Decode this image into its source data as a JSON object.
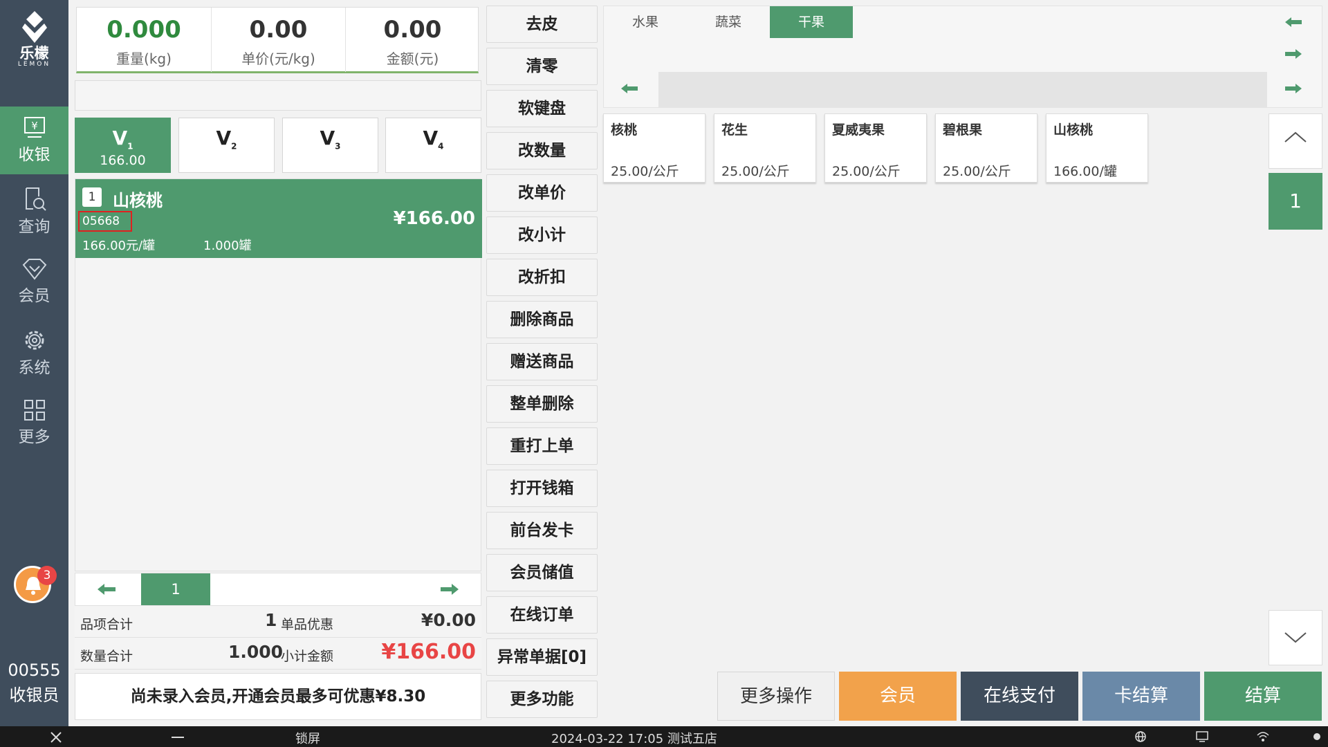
{
  "app": {
    "brand": "乐檬",
    "brand_sub": "LEMON"
  },
  "sidebar": {
    "items": [
      {
        "label": "收银",
        "icon": "cash-register-icon"
      },
      {
        "label": "查询",
        "icon": "search-doc-icon"
      },
      {
        "label": "会员",
        "icon": "diamond-icon"
      },
      {
        "label": "系统",
        "icon": "gear-icon"
      },
      {
        "label": "更多",
        "icon": "grid-icon"
      }
    ],
    "notification_count": "3",
    "cashier_id": "00555",
    "cashier_role": "收银员"
  },
  "scale": {
    "weight": {
      "value": "0.000",
      "label": "重量(kg)"
    },
    "unit_price": {
      "value": "0.00",
      "label": "单价(元/kg)"
    },
    "amount": {
      "value": "0.00",
      "label": "金额(元)"
    }
  },
  "vtabs": [
    {
      "name": "V",
      "sub": "1",
      "amount": "166.00"
    },
    {
      "name": "V",
      "sub": "2",
      "amount": ""
    },
    {
      "name": "V",
      "sub": "3",
      "amount": ""
    },
    {
      "name": "V",
      "sub": "4",
      "amount": ""
    }
  ],
  "cart": {
    "items": [
      {
        "line": "1",
        "name": "山核桃",
        "code": "05668",
        "total": "¥166.00",
        "price": "166.00元/罐",
        "qty": "1.000罐"
      }
    ],
    "page": "1"
  },
  "summary": {
    "item_count_label": "品项合计",
    "item_count": "1",
    "discount_label": "单品优惠",
    "discount": "¥0.00",
    "qty_label": "数量合计",
    "qty": "1.000",
    "subtotal_label": "小计金额",
    "subtotal": "¥166.00"
  },
  "promo_text": "尚未录入会员,开通会员最多可优惠¥8.30",
  "functions": [
    "去皮",
    "清零",
    "软键盘",
    "改数量",
    "改单价",
    "改小计",
    "改折扣",
    "删除商品",
    "赠送商品",
    "整单删除",
    "重打上单",
    "打开钱箱",
    "前台发卡",
    "会员储值",
    "在线订单",
    "异常单据[0]",
    "更多功能"
  ],
  "categories": [
    "水果",
    "蔬菜",
    "干果"
  ],
  "products": [
    {
      "name": "核桃",
      "price": "25.00/公斤"
    },
    {
      "name": "花生",
      "price": "25.00/公斤"
    },
    {
      "name": "夏威夷果",
      "price": "25.00/公斤"
    },
    {
      "name": "碧根果",
      "price": "25.00/公斤"
    },
    {
      "name": "山核桃",
      "price": "166.00/罐"
    }
  ],
  "product_page": "1",
  "actions": {
    "more": "更多操作",
    "member": "会员",
    "online": "在线支付",
    "card": "卡结算",
    "checkout": "结算"
  },
  "statusbar": {
    "lock": "锁屏",
    "datetime_store": "2024-03-22 17:05 测试五店"
  },
  "colors": {
    "accent": "#4f9a6e",
    "sidebar": "#3f4d5c",
    "member": "#f2a24b",
    "card": "#6a89a8",
    "price_red": "#e84545"
  }
}
